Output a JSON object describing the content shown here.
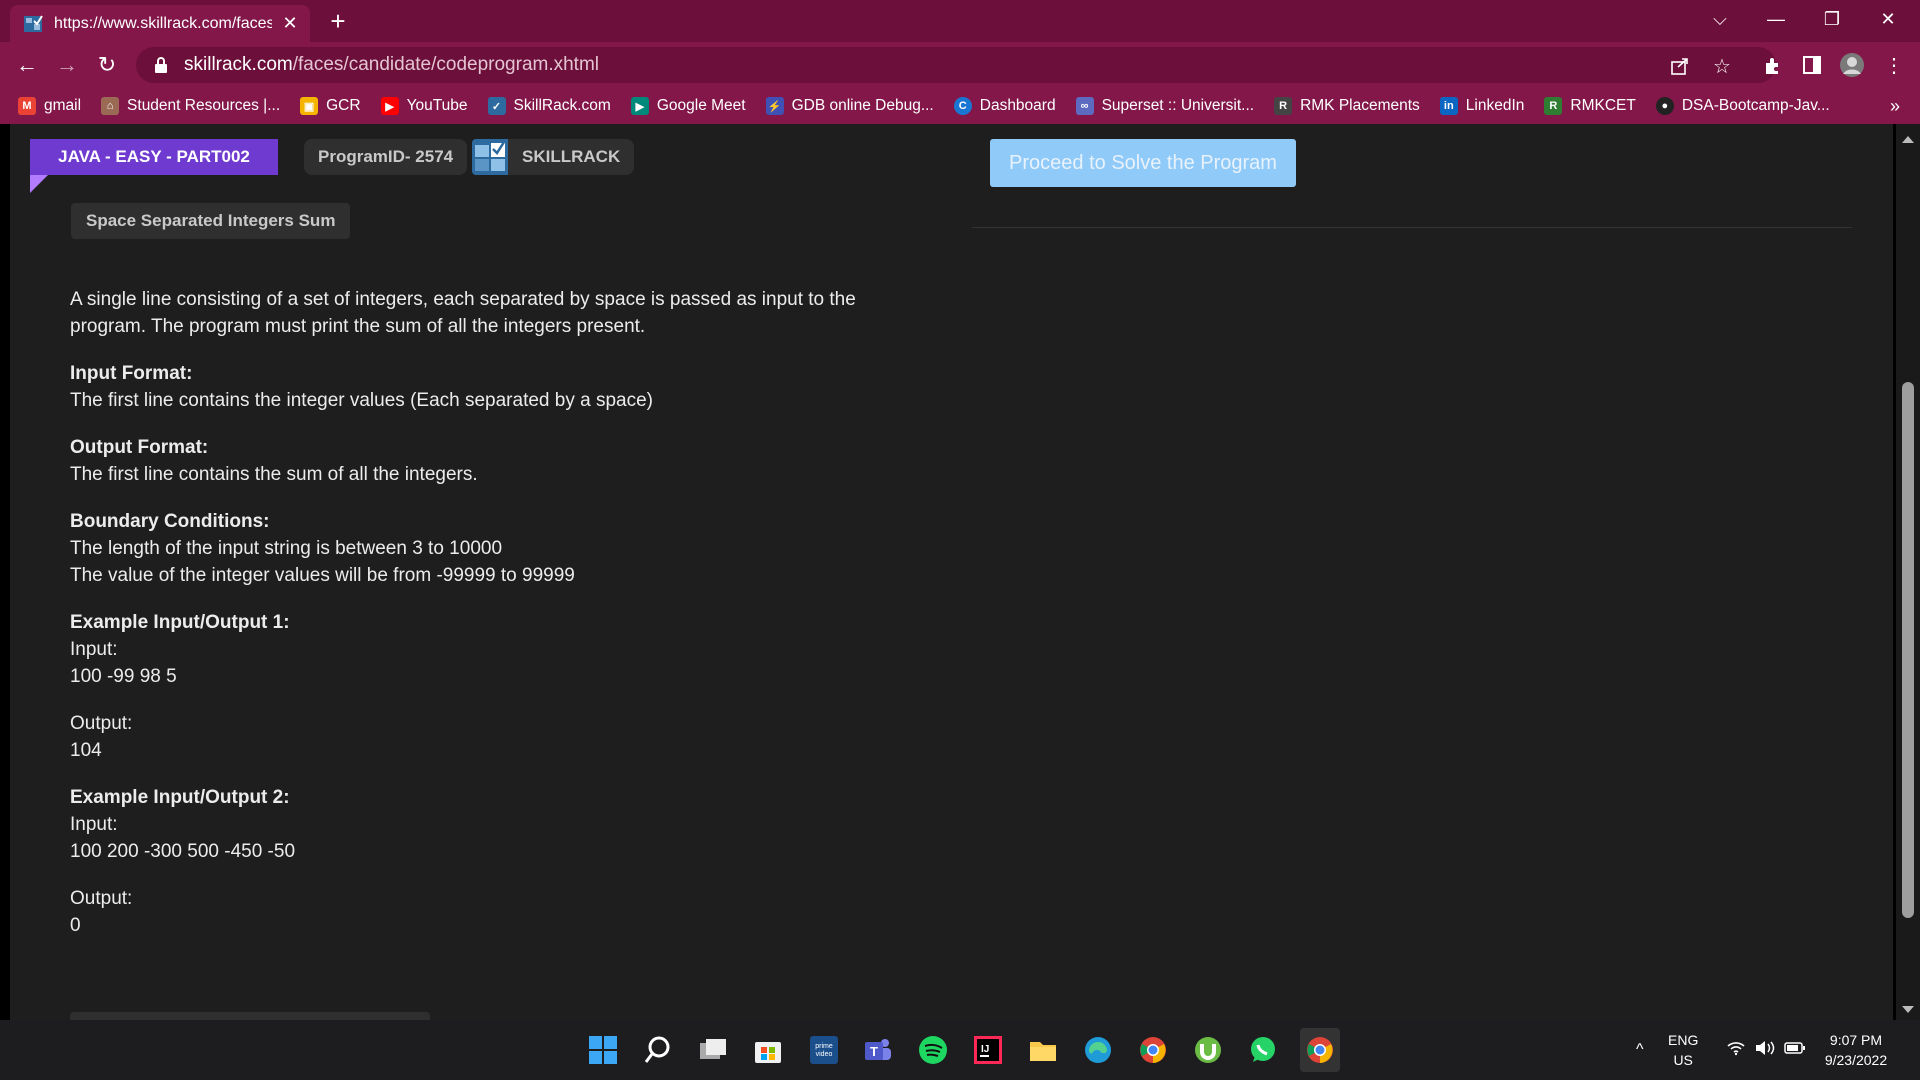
{
  "browser": {
    "tab_title": "https://www.skillrack.com/faces/candidate/codeprogram.xhtml",
    "url_host": "skillrack.com",
    "url_path": "/faces/candidate/codeprogram.xhtml",
    "new_tab": "+",
    "tab_close": "✕",
    "minimize": "—",
    "restore": "❐",
    "close": "✕",
    "dropdown": "⌵",
    "back": "←",
    "forward": "→",
    "reload": "↻",
    "menu": "⋮",
    "more": "»"
  },
  "bookmarks": [
    {
      "label": "gmail",
      "icon": "gmail-icon",
      "color": "#ea4335",
      "glyph": "M"
    },
    {
      "label": "Student Resources |...",
      "icon": "resources-icon",
      "color": "#9a6a55",
      "glyph": "⌂"
    },
    {
      "label": "GCR",
      "icon": "classroom-icon",
      "color": "#f4b400",
      "glyph": "▣"
    },
    {
      "label": "YouTube",
      "icon": "youtube-icon",
      "color": "#ff0000",
      "glyph": "▶"
    },
    {
      "label": "SkillRack.com",
      "icon": "skillrack-icon",
      "color": "#2c6aa0",
      "glyph": "✓"
    },
    {
      "label": "Google Meet",
      "icon": "meet-icon",
      "color": "#00897b",
      "glyph": "▶"
    },
    {
      "label": "GDB online Debug...",
      "icon": "gdb-icon",
      "color": "#3f51b5",
      "glyph": "⚡"
    },
    {
      "label": "Dashboard",
      "icon": "dashboard-icon",
      "color": "#1976d2",
      "glyph": "C"
    },
    {
      "label": "Superset :: Universit...",
      "icon": "superset-icon",
      "color": "#5c6bc0",
      "glyph": "∞"
    },
    {
      "label": "RMK Placements",
      "icon": "rmk-icon",
      "color": "#444",
      "glyph": "R"
    },
    {
      "label": "LinkedIn",
      "icon": "linkedin-icon",
      "color": "#0a66c2",
      "glyph": "in"
    },
    {
      "label": "RMKCET",
      "icon": "rmkcet-icon",
      "color": "#2e7d32",
      "glyph": "R"
    },
    {
      "label": "DSA-Bootcamp-Jav...",
      "icon": "github-icon",
      "color": "#222",
      "glyph": "●"
    }
  ],
  "header": {
    "category": "JAVA - EASY - PART002",
    "program_id": "ProgramID- 2574",
    "brand": "SKILLRACK",
    "program_title": "Space Separated Integers Sum",
    "proceed_button": "Proceed to Solve the Program"
  },
  "problem": {
    "description": "A single line consisting of a set of integers, each separated by space is passed as input to the program. The program must print the sum of all the integers present.",
    "input_format_heading": "Input Format:",
    "input_format": "The first line contains the integer values (Each separated by a space)",
    "output_format_heading": "Output Format:",
    "output_format": "The first line contains the sum of all the integers.",
    "boundary_heading": "Boundary Conditions:",
    "boundary_1": "The length of the input string is between 3 to 10000",
    "boundary_2": "The value of the integer values will be from -99999 to 99999",
    "example1_heading": "Example Input/Output 1:",
    "example1_input_label": "Input:",
    "example1_input": "100 -99 98 5",
    "example1_output_label": "Output:",
    "example1_output": "104",
    "example2_heading": "Example Input/Output 2:",
    "example2_input_label": "Input:",
    "example2_input": "100 200 -300 500 -450 -50",
    "example2_output_label": "Output:",
    "example2_output": "0"
  },
  "taskbar": {
    "lang_1": "ENG",
    "lang_2": "US",
    "time": "9:07 PM",
    "date": "9/23/2022",
    "chevron": "^"
  }
}
